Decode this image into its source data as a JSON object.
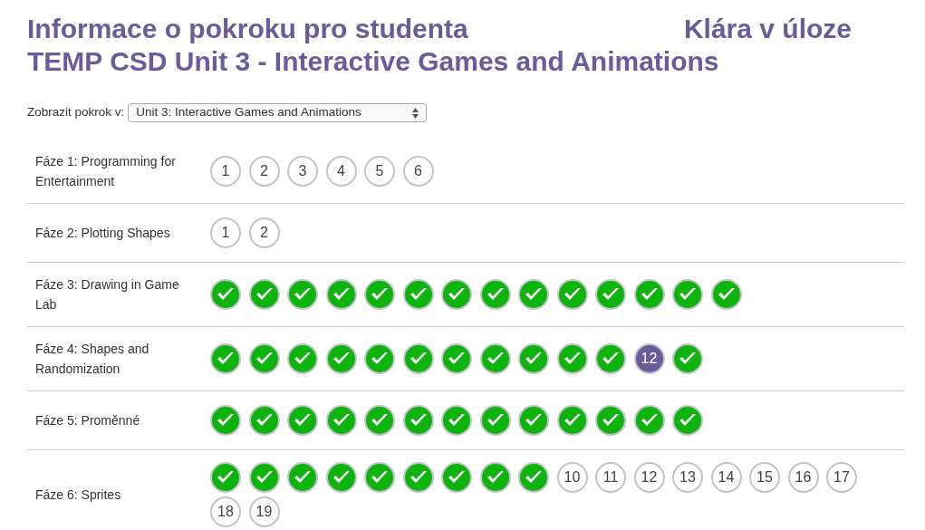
{
  "title": [
    "Informace o pokroku pro studenta",
    "Klára v úloze",
    "TEMP CSD Unit 3 - Interactive Games and Animations"
  ],
  "selector": {
    "label": "Zobrazit pokrok v:",
    "value": "Unit 3: Interactive Games and Animations"
  },
  "stages": [
    {
      "name": "Fáze 1: Programming for Entertainment",
      "levels": [
        {
          "kind": "todo",
          "label": "1"
        },
        {
          "kind": "todo",
          "label": "2"
        },
        {
          "kind": "todo",
          "label": "3"
        },
        {
          "kind": "todo",
          "label": "4"
        },
        {
          "kind": "todo",
          "label": "5"
        },
        {
          "kind": "todo",
          "label": "6"
        }
      ]
    },
    {
      "name": "Fáze 2: Plotting Shapes",
      "levels": [
        {
          "kind": "todo",
          "label": "1"
        },
        {
          "kind": "todo",
          "label": "2"
        }
      ]
    },
    {
      "name": "Fáze 3: Drawing in Game Lab",
      "levels": [
        {
          "kind": "done"
        },
        {
          "kind": "done"
        },
        {
          "kind": "done"
        },
        {
          "kind": "done"
        },
        {
          "kind": "done"
        },
        {
          "kind": "done"
        },
        {
          "kind": "done"
        },
        {
          "kind": "done"
        },
        {
          "kind": "done"
        },
        {
          "kind": "done"
        },
        {
          "kind": "done"
        },
        {
          "kind": "done"
        },
        {
          "kind": "done"
        },
        {
          "kind": "done"
        }
      ]
    },
    {
      "name": "Fáze 4: Shapes and Randomization",
      "levels": [
        {
          "kind": "done"
        },
        {
          "kind": "done"
        },
        {
          "kind": "done"
        },
        {
          "kind": "done"
        },
        {
          "kind": "done"
        },
        {
          "kind": "done"
        },
        {
          "kind": "done"
        },
        {
          "kind": "done"
        },
        {
          "kind": "done"
        },
        {
          "kind": "done"
        },
        {
          "kind": "done"
        },
        {
          "kind": "current",
          "label": "12"
        },
        {
          "kind": "done"
        }
      ]
    },
    {
      "name": "Fáze 5: Proměnné",
      "levels": [
        {
          "kind": "done"
        },
        {
          "kind": "done"
        },
        {
          "kind": "done"
        },
        {
          "kind": "done"
        },
        {
          "kind": "done"
        },
        {
          "kind": "done"
        },
        {
          "kind": "done"
        },
        {
          "kind": "done"
        },
        {
          "kind": "done"
        },
        {
          "kind": "done"
        },
        {
          "kind": "done"
        },
        {
          "kind": "done"
        },
        {
          "kind": "done"
        }
      ]
    },
    {
      "name": "Fáze 6: Sprites",
      "levels": [
        {
          "kind": "done"
        },
        {
          "kind": "done"
        },
        {
          "kind": "done"
        },
        {
          "kind": "done"
        },
        {
          "kind": "done"
        },
        {
          "kind": "done"
        },
        {
          "kind": "done"
        },
        {
          "kind": "done"
        },
        {
          "kind": "done"
        },
        {
          "kind": "todo",
          "label": "10"
        },
        {
          "kind": "todo",
          "label": "11"
        },
        {
          "kind": "todo",
          "label": "12"
        },
        {
          "kind": "todo",
          "label": "13"
        },
        {
          "kind": "todo",
          "label": "14"
        },
        {
          "kind": "todo",
          "label": "15"
        },
        {
          "kind": "todo",
          "label": "16"
        },
        {
          "kind": "todo",
          "label": "17"
        },
        {
          "kind": "todo",
          "label": "18"
        },
        {
          "kind": "todo",
          "label": "19"
        }
      ]
    }
  ]
}
